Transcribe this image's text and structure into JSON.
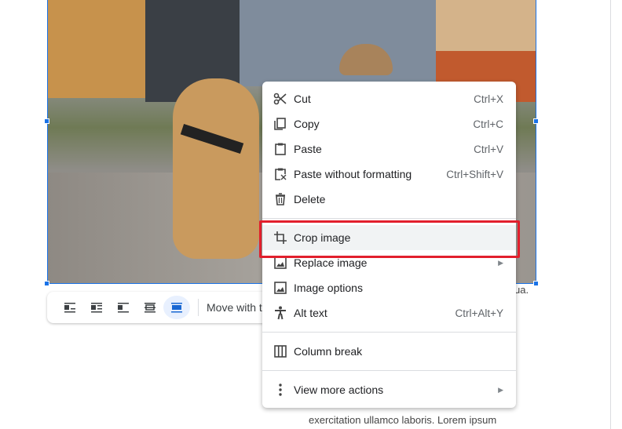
{
  "document": {
    "text_fragment_1": "ua.",
    "text_fragment_2": "exercitation ullamco laboris. Lorem ipsum"
  },
  "image_toolbar": {
    "wrap_options": [
      {
        "icon": "inline-icon",
        "active": false
      },
      {
        "icon": "wrap-text-icon",
        "active": false
      },
      {
        "icon": "break-text-icon",
        "active": false
      },
      {
        "icon": "behind-text-icon",
        "active": false
      },
      {
        "icon": "in-front-of-text-icon",
        "active": true
      }
    ],
    "move_label": "Move with t"
  },
  "context_menu": {
    "items": [
      {
        "icon": "scissors-icon",
        "label": "Cut",
        "shortcut": "Ctrl+X"
      },
      {
        "icon": "copy-icon",
        "label": "Copy",
        "shortcut": "Ctrl+C"
      },
      {
        "icon": "clipboard-icon",
        "label": "Paste",
        "shortcut": "Ctrl+V"
      },
      {
        "icon": "paste-plain-icon",
        "label": "Paste without formatting",
        "shortcut": "Ctrl+Shift+V"
      },
      {
        "icon": "trash-icon",
        "label": "Delete",
        "shortcut": ""
      },
      {
        "icon": "crop-icon",
        "label": "Crop image",
        "shortcut": "",
        "highlighted": true
      },
      {
        "icon": "image-icon",
        "label": "Replace image",
        "submenu": true
      },
      {
        "icon": "image-icon",
        "label": "Image options",
        "shortcut": ""
      },
      {
        "icon": "accessibility-icon",
        "label": "Alt text",
        "shortcut": "Ctrl+Alt+Y"
      },
      {
        "icon": "columns-icon",
        "label": "Column break",
        "shortcut": ""
      },
      {
        "icon": "more-vert-icon",
        "label": "View more actions",
        "submenu": true
      }
    ]
  },
  "colors": {
    "highlight_box": "#e21f2c",
    "selection": "#1a73e8"
  }
}
